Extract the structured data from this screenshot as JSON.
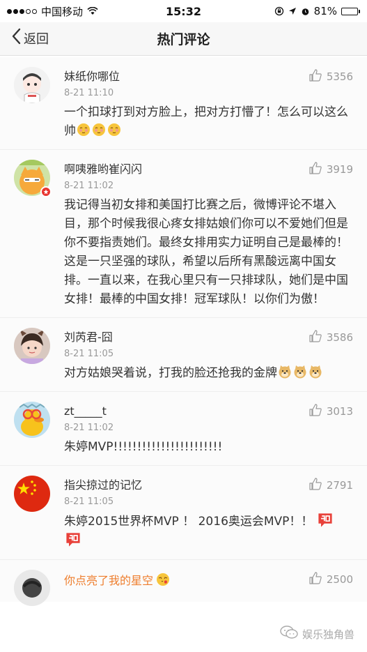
{
  "status": {
    "carrier": "中国移动",
    "time": "15:32",
    "battery": "81%"
  },
  "nav": {
    "back_label": "返回",
    "title": "热门评论"
  },
  "comments": [
    {
      "name": "妹纸你哪位",
      "time": "8-21 11:10",
      "likes": "5356",
      "text": "一个扣球打到对方脸上，把对方打懵了！怎么可以这么帅",
      "emojis": [
        "blush-emoji",
        "blush-emoji",
        "blush-emoji"
      ]
    },
    {
      "name": "啊咦雅哟崔闪闪",
      "time": "8-21 11:02",
      "likes": "3919",
      "text": "我记得当初女排和美国打比赛之后，微博评论不堪入目，那个时候我很心疼女排姑娘们你可以不爱她们但是你不要指责她们。最终女排用实力证明自己是最棒的！这是一只坚强的球队，希望以后所有黑酸远离中国女排。一直以来，在我心里只有一只排球队，她们是中国女排！最棒的中国女排！冠军球队！以你们为傲！"
    },
    {
      "name": "刘芮君-囧",
      "time": "8-21 11:05",
      "likes": "3586",
      "text": "对方姑娘哭着说，打我的脸还抢我的金牌",
      "emojis": [
        "doge-emoji",
        "doge-emoji",
        "doge-emoji"
      ]
    },
    {
      "name": "zt_____t",
      "time": "8-21 11:02",
      "likes": "3013",
      "text": "朱婷MVP!!!!!!!!!!!!!!!!!!!!!!!"
    },
    {
      "name": "指尖掠过的记忆",
      "time": "8-21 11:05",
      "likes": "2791",
      "text": "朱婷2015世界杯MVP ！ 2016奥运会MVP！！",
      "emojis": [
        "jiayou-emoji",
        "jiayou-emoji"
      ]
    },
    {
      "name": "你点亮了我的星空",
      "likes": "2500"
    }
  ],
  "watermark": "娱乐独角兽",
  "colors": {
    "highlight_name": "#ee7d2c",
    "badge_red": "#e8342f"
  }
}
